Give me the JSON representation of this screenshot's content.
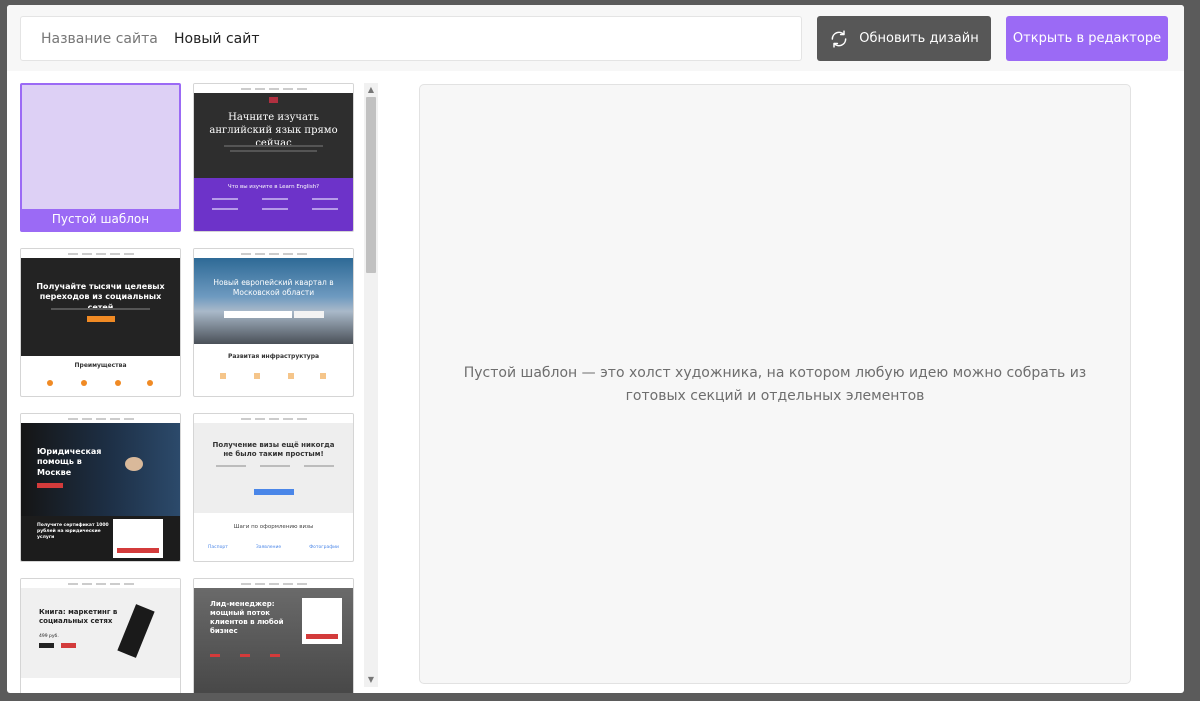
{
  "header": {
    "site_name_label": "Название сайта",
    "site_name_value": "Новый сайт",
    "refresh_label": "Обновить дизайн",
    "refresh_icon": "refresh-icon",
    "open_label": "Открыть в редакторе"
  },
  "templates": {
    "blank_label": "Пустой шаблон",
    "items": [
      {
        "title": "Начните изучать английский язык прямо сейчас",
        "section": "Что вы изучите в Learn English?"
      },
      {
        "title": "Получайте тысячи целевых переходов из социальных сетей",
        "section": "Преимущества"
      },
      {
        "title": "Новый европейский квартал в Московской области",
        "section": "Развитая инфраструктура"
      },
      {
        "title": "Юридическая помощь в Москве",
        "section": "Получите сертификат 1000 рублей на юридические услуги"
      },
      {
        "title": "Получение визы ещё никогда не было таким простым!",
        "section": "Шаги по оформлению визы",
        "steps": [
          "Паспорт",
          "Заявление",
          "Фотографии"
        ]
      },
      {
        "title": "Книга: маркетинг в социальных сетях",
        "price": "499 руб."
      },
      {
        "title": "Лид-менеджер: мощный поток клиентов в любой бизнес"
      }
    ]
  },
  "preview": {
    "description": "Пустой шаблон — это холст художника, на котором любую идею можно собрать из готовых секций и отдельных элементов"
  },
  "colors": {
    "accent": "#9b6af5",
    "refresh_button": "#575757"
  }
}
